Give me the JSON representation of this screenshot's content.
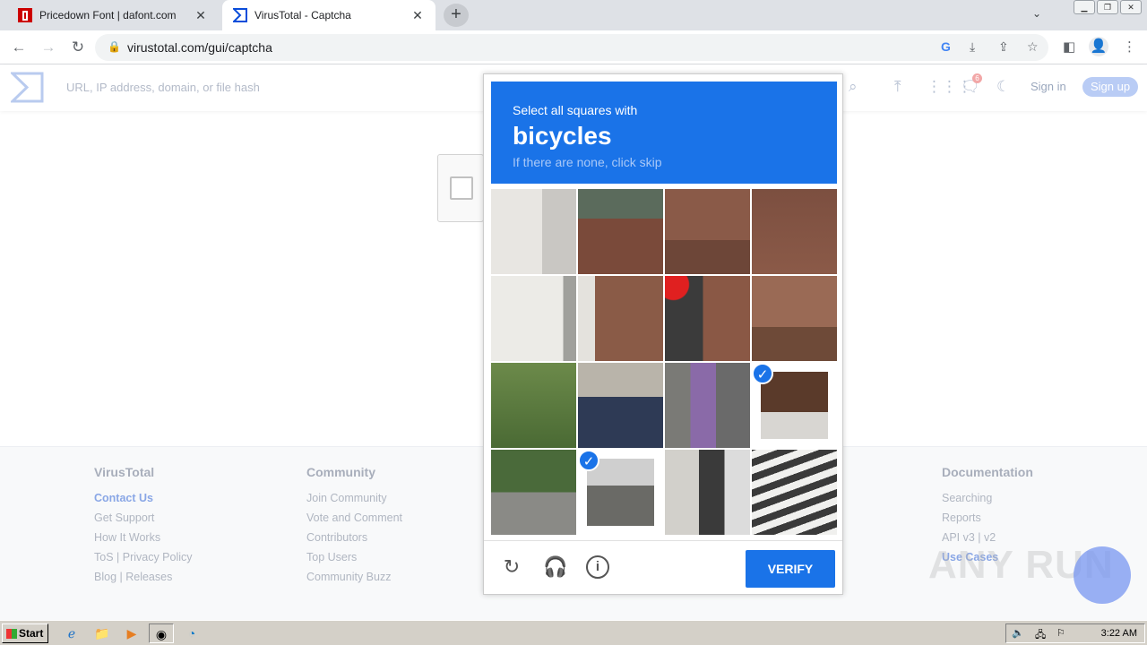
{
  "browser": {
    "tabs": [
      {
        "title": "Pricedown Font | dafont.com",
        "active": false
      },
      {
        "title": "VirusTotal - Captcha",
        "active": true
      }
    ],
    "new_tab": "+",
    "tab_close": "✕",
    "url": "virustotal.com/gui/captcha"
  },
  "vt": {
    "search_placeholder": "URL, IP address, domain, or file hash",
    "notification_count": "6",
    "sign_in": "Sign in",
    "sign_up": "Sign up",
    "brand_color": "#0b4dda"
  },
  "footer": {
    "columns": [
      {
        "heading": "VirusTotal",
        "links": [
          "Contact Us",
          "Get Support",
          "How It Works",
          "ToS | Privacy Policy",
          "Blog | Releases"
        ]
      },
      {
        "heading": "Community",
        "links": [
          "Join Community",
          "Vote and Comment",
          "Contributors",
          "Top Users",
          "Community Buzz"
        ]
      },
      {
        "heading": "Documentation",
        "links": [
          "Searching",
          "Reports",
          "API v3 | v2",
          "Use Cases"
        ]
      }
    ]
  },
  "captcha": {
    "line1": "Select all squares with",
    "target": "bicycles",
    "line3": "If there are none, click skip",
    "verify": "VERIFY",
    "selected_tiles": [
      11,
      13
    ],
    "accent": "#1a73e8"
  },
  "watermark": "ANY RUN",
  "taskbar": {
    "start": "Start",
    "time": "3:22 AM"
  }
}
